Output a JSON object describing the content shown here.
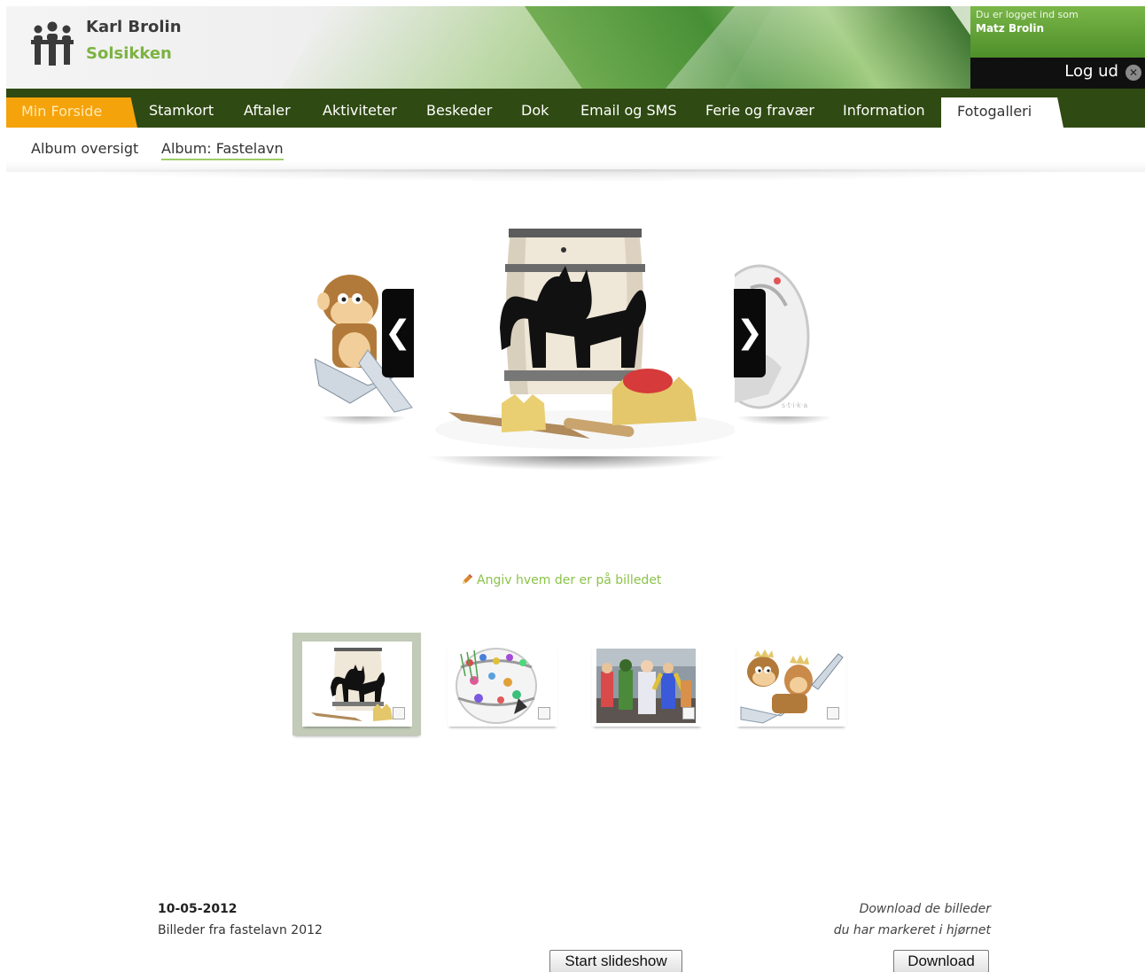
{
  "header": {
    "site_name": "Karl Brolin",
    "site_sub": "Solsikken",
    "login_label": "Du er logget ind som",
    "login_user": "Matz Brolin",
    "logout_label": "Log ud",
    "logout_icon": "close-icon"
  },
  "nav": {
    "items": [
      {
        "label": "Min Forside"
      },
      {
        "label": "Stamkort"
      },
      {
        "label": "Aftaler"
      },
      {
        "label": "Aktiviteter"
      },
      {
        "label": "Beskeder"
      },
      {
        "label": "Dok"
      },
      {
        "label": "Email og SMS"
      },
      {
        "label": "Ferie og fravær"
      },
      {
        "label": "Information"
      },
      {
        "label": "Fotogalleri"
      }
    ],
    "colors": {
      "bar": "#2f4a12",
      "home": "#f5a30b",
      "current": "#ffffff"
    }
  },
  "subnav": {
    "items": [
      {
        "label": "Album oversigt"
      },
      {
        "label": "Album: Fastelavn"
      }
    ]
  },
  "carousel": {
    "prev_label": "❮",
    "next_label": "❯",
    "tag_link": "Angiv hvem der er på billedet"
  },
  "thumbnails": [
    {
      "name": "barrel",
      "selected": true
    },
    {
      "name": "decorated-barrel",
      "selected": false
    },
    {
      "name": "costumes",
      "selected": false
    },
    {
      "name": "monkey",
      "selected": false
    }
  ],
  "album": {
    "date": "10-05-2012",
    "description": "Billeder fra fastelavn 2012",
    "download_note_1": "Download de billeder",
    "download_note_2": "du har markeret i hjørnet",
    "slideshow_button": "Start slideshow",
    "download_button": "Download"
  }
}
